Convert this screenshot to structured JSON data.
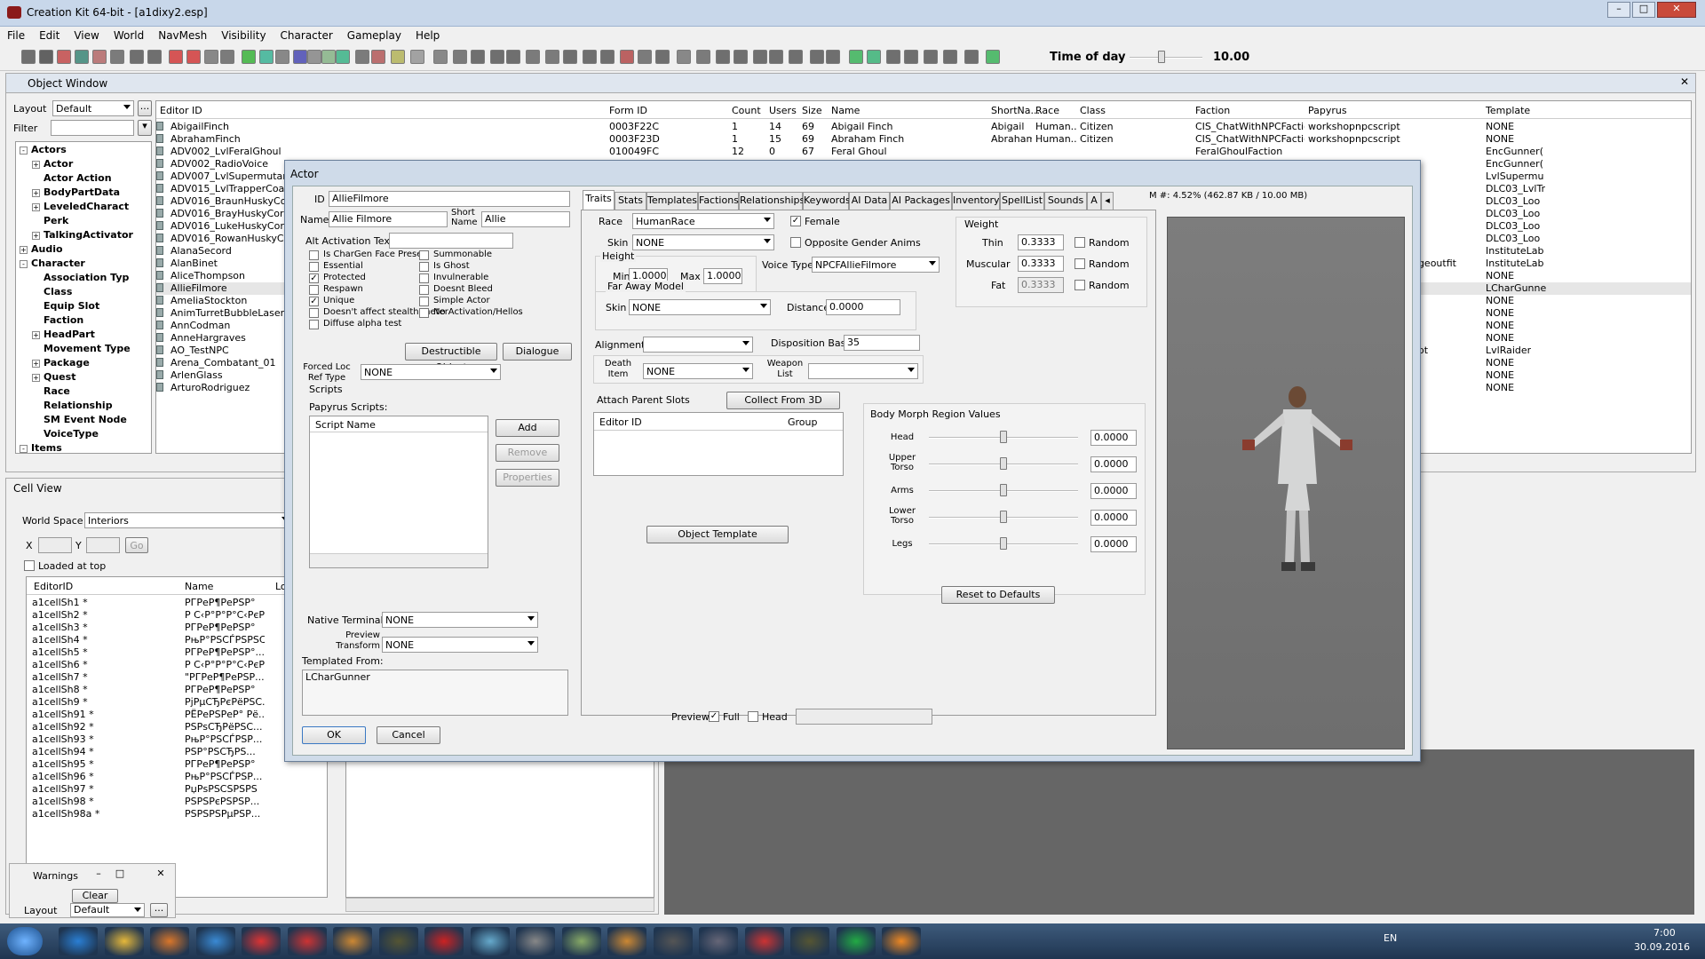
{
  "window": {
    "title": "Creation Kit 64-bit - [a1dixy2.esp]"
  },
  "menu": [
    "File",
    "Edit",
    "View",
    "World",
    "NavMesh",
    "Visibility",
    "Character",
    "Gameplay",
    "Help"
  ],
  "toolbar": {
    "time_of_day_label": "Time of day",
    "time_of_day_value": "10.00"
  },
  "object_window": {
    "title": "Object Window",
    "layout_label": "Layout",
    "layout_value": "Default",
    "filter_label": "Filter",
    "tree": [
      {
        "label": "Actors",
        "level": 0,
        "exp": "-"
      },
      {
        "label": "Actor",
        "level": 1,
        "exp": "+"
      },
      {
        "label": "Actor Action",
        "level": 1,
        "exp": ""
      },
      {
        "label": "BodyPartData",
        "level": 1,
        "exp": "+"
      },
      {
        "label": "LeveledCharact",
        "level": 1,
        "exp": "+"
      },
      {
        "label": "Perk",
        "level": 1,
        "exp": ""
      },
      {
        "label": "TalkingActivator",
        "level": 1,
        "exp": "+"
      },
      {
        "label": "Audio",
        "level": 0,
        "exp": "+"
      },
      {
        "label": "Character",
        "level": 0,
        "exp": "-"
      },
      {
        "label": "Association Typ",
        "level": 1,
        "exp": ""
      },
      {
        "label": "Class",
        "level": 1,
        "exp": ""
      },
      {
        "label": "Equip Slot",
        "level": 1,
        "exp": ""
      },
      {
        "label": "Faction",
        "level": 1,
        "exp": ""
      },
      {
        "label": "HeadPart",
        "level": 1,
        "exp": "+"
      },
      {
        "label": "Movement Type",
        "level": 1,
        "exp": ""
      },
      {
        "label": "Package",
        "level": 1,
        "exp": "+"
      },
      {
        "label": "Quest",
        "level": 1,
        "exp": "+"
      },
      {
        "label": "Race",
        "level": 1,
        "exp": ""
      },
      {
        "label": "Relationship",
        "level": 1,
        "exp": ""
      },
      {
        "label": "SM Event Node",
        "level": 1,
        "exp": ""
      },
      {
        "label": "VoiceType",
        "level": 1,
        "exp": ""
      },
      {
        "label": "Items",
        "level": 0,
        "exp": "-"
      }
    ],
    "columns": [
      "Editor ID",
      "Form ID",
      "Count",
      "Users",
      "Size",
      "Name",
      "ShortNa...",
      "Race",
      "Class",
      "Faction",
      "Papyrus",
      "Template"
    ],
    "rows": [
      {
        "editor_id": "AbigailFinch",
        "form_id": "0003F22C",
        "count": "1",
        "users": "14",
        "size": "69",
        "name": "Abigail Finch",
        "short": "Abigail",
        "race": "Human...",
        "class": "Citizen",
        "faction": "CIS_ChatWithNPCFaction_...",
        "papyrus": "workshopnpcscript",
        "template": "NONE"
      },
      {
        "editor_id": "AbrahamFinch",
        "form_id": "0003F23D",
        "count": "1",
        "users": "15",
        "size": "69",
        "name": "Abraham Finch",
        "short": "Abraham",
        "race": "Human...",
        "class": "Citizen",
        "faction": "CIS_ChatWithNPCFaction_...",
        "papyrus": "workshopnpcscript",
        "template": "NONE"
      },
      {
        "editor_id": "ADV002_LvlFeralGhoul",
        "form_id": "010049FC",
        "count": "12",
        "users": "0",
        "size": "67",
        "name": "Feral Ghoul",
        "short": "",
        "race": "",
        "class": "",
        "faction": "FeralGhoulFaction",
        "papyrus": "",
        "template": "EncGunner("
      },
      {
        "editor_id": "ADV002_RadioVoice",
        "form_id": "",
        "count": "",
        "users": "",
        "size": "",
        "name": "",
        "short": "",
        "race": "",
        "class": "",
        "faction": "",
        "papyrus": "",
        "template": "EncGunner("
      },
      {
        "editor_id": "ADV007_LvlSupermutantM",
        "form_id": "",
        "count": "",
        "users": "",
        "size": "",
        "name": "",
        "short": "",
        "race": "",
        "class": "",
        "faction": "",
        "papyrus": "",
        "template": "LvlSupermu"
      },
      {
        "editor_id": "ADV015_LvlTrapperCoast",
        "form_id": "",
        "count": "",
        "users": "",
        "size": "",
        "name": "",
        "short": "",
        "race": "",
        "class": "",
        "faction": "",
        "papyrus": "",
        "template": "DLC03_LvlTr"
      },
      {
        "editor_id": "ADV016_BraunHuskyCorps",
        "form_id": "",
        "count": "",
        "users": "",
        "size": "",
        "name": "",
        "short": "",
        "race": "",
        "class": "",
        "faction": "",
        "papyrus": "",
        "template": "DLC03_Loo"
      },
      {
        "editor_id": "ADV016_BrayHuskyCorps",
        "form_id": "",
        "count": "",
        "users": "",
        "size": "",
        "name": "",
        "short": "",
        "race": "",
        "class": "",
        "faction": "",
        "papyrus": "",
        "template": "DLC03_Loo"
      },
      {
        "editor_id": "ADV016_LukeHuskyCorps",
        "form_id": "",
        "count": "",
        "users": "",
        "size": "",
        "name": "",
        "short": "",
        "race": "",
        "class": "",
        "faction": "",
        "papyrus": "",
        "template": "DLC03_Loo"
      },
      {
        "editor_id": "ADV016_RowanHuskyCorps",
        "form_id": "",
        "count": "",
        "users": "",
        "size": "",
        "name": "",
        "short": "",
        "race": "",
        "class": "",
        "faction": "",
        "papyrus": "",
        "template": "DLC03_Loo"
      },
      {
        "editor_id": "AlanaSecord",
        "form_id": "",
        "count": "",
        "users": "",
        "size": "",
        "name": "",
        "short": "",
        "race": "",
        "class": "",
        "faction": "",
        "papyrus": "",
        "template": "InstituteLab"
      },
      {
        "editor_id": "AlanBinet",
        "form_id": "",
        "count": "",
        "users": "",
        "size": "",
        "name": "",
        "short": "",
        "race": "",
        "class": "",
        "faction": "",
        "papyrus": "faultrefonlocationchangeoutfit",
        "template": "InstituteLab"
      },
      {
        "editor_id": "AliceThompson",
        "form_id": "",
        "count": "",
        "users": "",
        "size": "",
        "name": "",
        "short": "",
        "race": "",
        "class": "",
        "faction": "",
        "papyrus": "",
        "template": "NONE"
      },
      {
        "editor_id": "AllieFilmore",
        "form_id": "",
        "count": "",
        "users": "",
        "size": "",
        "name": "",
        "short": "",
        "race": "",
        "class": "",
        "faction": "",
        "papyrus": "",
        "template": "LCharGunne"
      },
      {
        "editor_id": "AmeliaStockton",
        "form_id": "",
        "count": "",
        "users": "",
        "size": "",
        "name": "",
        "short": "",
        "race": "",
        "class": "",
        "faction": "",
        "papyrus": "",
        "template": "NONE"
      },
      {
        "editor_id": "AnimTurretBubbleLaserTest",
        "form_id": "",
        "count": "",
        "users": "",
        "size": "",
        "name": "",
        "short": "",
        "race": "",
        "class": "",
        "faction": "",
        "papyrus": "",
        "template": "NONE"
      },
      {
        "editor_id": "AnnCodman",
        "form_id": "",
        "count": "",
        "users": "",
        "size": "",
        "name": "",
        "short": "",
        "race": "",
        "class": "",
        "faction": "",
        "papyrus": "",
        "template": "NONE"
      },
      {
        "editor_id": "AnneHargraves",
        "form_id": "",
        "count": "",
        "users": "",
        "size": "",
        "name": "",
        "short": "",
        "race": "",
        "class": "",
        "faction": "",
        "papyrus": "workshopnpcscript",
        "template": "NONE"
      },
      {
        "editor_id": "AO_TestNPC",
        "form_id": "",
        "count": "",
        "users": "",
        "size": "",
        "name": "",
        "short": "",
        "race": "",
        "class": "",
        "faction": "",
        "papyrus": "ractionObjectActorScript",
        "template": "LvlRaider"
      },
      {
        "editor_id": "Arena_Combatant_01",
        "form_id": "",
        "count": "",
        "users": "",
        "size": "",
        "name": "",
        "short": "",
        "race": "",
        "class": "",
        "faction": "",
        "papyrus": "",
        "template": "NONE"
      },
      {
        "editor_id": "ArlenGlass",
        "form_id": "",
        "count": "",
        "users": "",
        "size": "",
        "name": "",
        "short": "",
        "race": "",
        "class": "",
        "faction": "",
        "papyrus": "",
        "template": "NONE"
      },
      {
        "editor_id": "ArturoRodriguez",
        "form_id": "",
        "count": "",
        "users": "",
        "size": "",
        "name": "",
        "short": "",
        "race": "",
        "class": "",
        "faction": "",
        "papyrus": "",
        "template": "NONE"
      }
    ]
  },
  "cell_view": {
    "title": "Cell View",
    "worldspace_label": "World Space",
    "worldspace_value": "Interiors",
    "x_label": "X",
    "y_label": "Y",
    "go_label": "Go",
    "loaded_at_top": "Loaded at top",
    "columns": [
      "EditorID",
      "Name",
      "Lo"
    ],
    "rows": [
      {
        "id": "a1cellSh1 *",
        "name": "РГРеР¶РеРЅР°"
      },
      {
        "id": "a1cellSh2 *",
        "name": "Р С‹Р°Р°Р°С‹РєРµ"
      },
      {
        "id": "a1cellSh3 *",
        "name": "РГРеР¶РеРЅР°"
      },
      {
        "id": "a1cellSh4 *",
        "name": "РњР°РЅСЃРЅРЅСЃР°"
      },
      {
        "id": "a1cellSh5 *",
        "name": "РГРеР¶РеРЅР°..."
      },
      {
        "id": "a1cellSh6 *",
        "name": "Р С‹Р°Р°Р°С‹РєРµ"
      },
      {
        "id": "a1cellSh7 *",
        "name": "\"РГРеР¶РеРЅР..."
      },
      {
        "id": "a1cellSh8 *",
        "name": "РГРеР¶РеРЅР°"
      },
      {
        "id": "a1cellSh9 *",
        "name": "РјРµСЂРєРёРЅС..."
      },
      {
        "id": "a1cellSh91 *",
        "name": "РЁРеРЅРеР° Рё..."
      },
      {
        "id": "a1cellSh92 *",
        "name": "РЅРѕСЂРёРЅС..."
      },
      {
        "id": "a1cellSh93 *",
        "name": "РњР°РЅСЃРЅР..."
      },
      {
        "id": "a1cellSh94 *",
        "name": "РЅР°РЅСЂРЅ..."
      },
      {
        "id": "a1cellSh95 *",
        "name": "РГРеР¶РеРЅР°"
      },
      {
        "id": "a1cellSh96 *",
        "name": "РњР°РЅСЃРЅР..."
      },
      {
        "id": "a1cellSh97 *",
        "name": "РџРѕРЅСЅРЅРЅ"
      },
      {
        "id": "a1cellSh98 *",
        "name": "РЅРЅРєРЅРЅР..."
      },
      {
        "id": "a1cellSh98a *",
        "name": "РЅРЅРЅРµРЅР..."
      }
    ]
  },
  "warnings": {
    "title": "Warnings",
    "clear": "Clear",
    "layout_label": "Layout",
    "layout_value": "Default"
  },
  "dialog": {
    "title": "Actor",
    "id_label": "ID",
    "id_value": "AllieFilmore",
    "name_label": "Name",
    "name_value": "Allie Filmore",
    "short_label": "Short Name",
    "short_value": "Allie",
    "alt_label": "Alt Activation Text",
    "checks_left": [
      {
        "label": "Is CharGen Face Preset",
        "checked": false
      },
      {
        "label": "Essential",
        "checked": false
      },
      {
        "label": "Protected",
        "checked": true
      },
      {
        "label": "Respawn",
        "checked": false
      },
      {
        "label": "Unique",
        "checked": true
      },
      {
        "label": "Doesn't affect stealth meter",
        "checked": false
      },
      {
        "label": "Diffuse alpha test",
        "checked": false
      }
    ],
    "checks_right": [
      {
        "label": "Summonable",
        "checked": false
      },
      {
        "label": "Is Ghost",
        "checked": false
      },
      {
        "label": "Invulnerable",
        "checked": false
      },
      {
        "label": "Doesnt Bleed",
        "checked": false
      },
      {
        "label": "Simple Actor",
        "checked": false
      },
      {
        "label": "No Activation/Hellos",
        "checked": false
      }
    ],
    "destructible_btn": "Destructible Object",
    "dialogue_btn": "Dialogue",
    "forced_loc_label": "Forced Loc Ref Type",
    "forced_loc_value": "NONE",
    "scripts_label": "Scripts",
    "papyrus_label": "Papyrus Scripts:",
    "script_name_col": "Script Name",
    "add_btn": "Add",
    "remove_btn": "Remove",
    "properties_btn": "Properties",
    "native_terminal_label": "Native Terminal",
    "native_terminal_value": "NONE",
    "preview_transform_label": "Preview Transform",
    "preview_transform_value": "NONE",
    "templated_label": "Templated From:",
    "templated_value": "LCharGunner",
    "ok_btn": "OK",
    "cancel_btn": "Cancel",
    "tabs": [
      "Traits",
      "Stats",
      "Templates",
      "Factions",
      "Relationships",
      "Keywords",
      "AI Data",
      "AI Packages",
      "Inventory",
      "SpellList",
      "Sounds",
      "A"
    ],
    "mem": "M #: 4.52% (462.87 KB / 10.00 MB)",
    "race_label": "Race",
    "race_value": "HumanRace",
    "female_label": "Female",
    "female_checked": true,
    "skin_label": "Skin",
    "skin_value": "NONE",
    "opposite_label": "Opposite Gender Anims",
    "height_label": "Height",
    "min_label": "Min",
    "min_value": "1.0000",
    "max_label": "Max",
    "max_value": "1.0000",
    "voice_label": "Voice Type",
    "voice_value": "NPCFAllieFilmore",
    "weight_label": "Weight",
    "weights": [
      {
        "label": "Thin",
        "value": "0.3333",
        "random": "Random"
      },
      {
        "label": "Muscular",
        "value": "0.3333",
        "random": "Random"
      },
      {
        "label": "Fat",
        "value": "0.3333",
        "random": "Random"
      }
    ],
    "far_label": "Far Away Model",
    "far_skin_label": "Skin",
    "far_skin_value": "NONE",
    "distance_label": "Distance",
    "distance_value": "0.0000",
    "alignment_label": "Alignment",
    "alignment_value": "",
    "disposition_label": "Disposition Base",
    "disposition_value": "35",
    "death_label": "Death Item",
    "death_value": "NONE",
    "weapon_label": "Weapon List",
    "weapon_value": "",
    "attach_label": "Attach Parent Slots",
    "collect_btn": "Collect From 3D",
    "attach_cols": [
      "Editor ID",
      "Group"
    ],
    "object_template_btn": "Object Template",
    "morph_label": "Body Morph Region Values",
    "morphs": [
      {
        "label": "Head",
        "value": "0.0000",
        "level": 0.5
      },
      {
        "label": "Upper Torso",
        "value": "0.0000",
        "level": 0.5
      },
      {
        "label": "Arms",
        "value": "0.0000",
        "level": 0.5
      },
      {
        "label": "Lower Torso",
        "value": "0.0000",
        "level": 0.5
      },
      {
        "label": "Legs",
        "value": "0.0000",
        "level": 0.5
      }
    ],
    "reset_btn": "Reset to Defaults",
    "preview_label": "Preview",
    "full_label": "Full",
    "head_label": "Head"
  },
  "tray": {
    "lang": "EN",
    "time": "7:00",
    "date": "30.09.2016"
  }
}
